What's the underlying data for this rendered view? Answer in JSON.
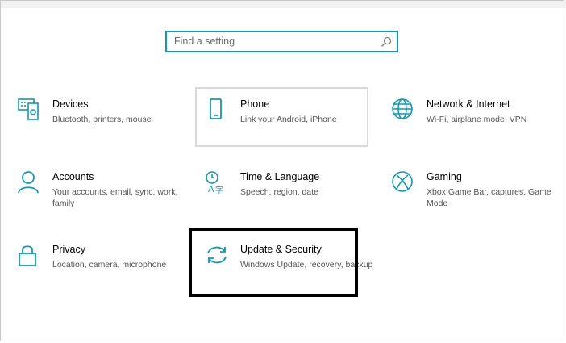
{
  "search": {
    "placeholder": "Find a setting"
  },
  "tiles": [
    {
      "id": "devices",
      "title": "Devices",
      "desc": "Bluetooth, printers, mouse",
      "icon": "keyboard-devices-icon"
    },
    {
      "id": "phone",
      "title": "Phone",
      "desc": "Link your Android, iPhone",
      "icon": "phone-icon"
    },
    {
      "id": "network",
      "title": "Network & Internet",
      "desc": "Wi-Fi, airplane mode, VPN",
      "icon": "globe-icon"
    },
    {
      "id": "accounts",
      "title": "Accounts",
      "desc": "Your accounts, email, sync, work, family",
      "icon": "person-icon"
    },
    {
      "id": "time",
      "title": "Time & Language",
      "desc": "Speech, region, date",
      "icon": "time-language-icon"
    },
    {
      "id": "gaming",
      "title": "Gaming",
      "desc": "Xbox Game Bar, captures, Game Mode",
      "icon": "xbox-icon"
    },
    {
      "id": "privacy",
      "title": "Privacy",
      "desc": "Location, camera, microphone",
      "icon": "lock-icon"
    },
    {
      "id": "update",
      "title": "Update & Security",
      "desc": "Windows Update, recovery, backup",
      "icon": "sync-arrows-icon"
    }
  ],
  "colors": {
    "accent": "#0e9ab4",
    "highlight": "#000000"
  }
}
